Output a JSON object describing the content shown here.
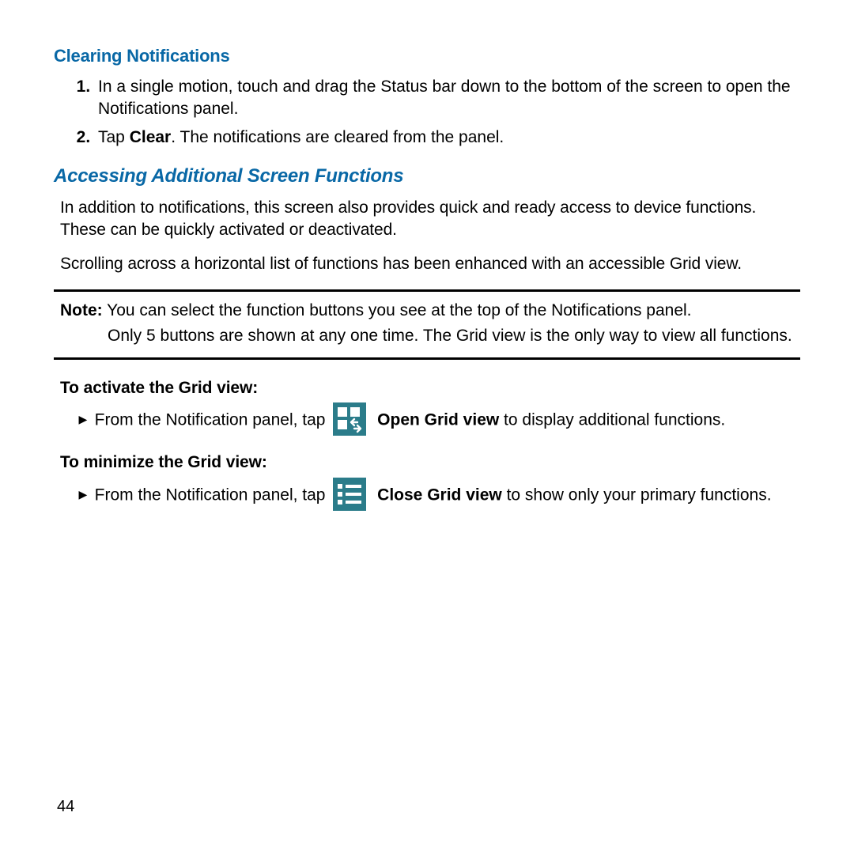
{
  "section1": {
    "heading": "Clearing Notifications",
    "steps": [
      {
        "text_before": "In a single motion, touch and drag the Status bar down to the bottom of the screen to open the Notifications panel."
      },
      {
        "text_before": "Tap ",
        "bold": "Clear",
        "text_after": ". The notifications are cleared from the panel."
      }
    ]
  },
  "section2": {
    "heading": "Accessing Additional Screen Functions",
    "para1": "In addition to notifications, this screen also provides quick and ready access to device functions. These can be quickly activated or deactivated.",
    "para2": "Scrolling across a horizontal list of functions has been enhanced with an accessible Grid view."
  },
  "note": {
    "label": "Note:",
    "line1": " You can select the function buttons you see at the top of the Notifications panel.",
    "line2": "Only 5 buttons are shown at any one time. The Grid view is the only way to view all functions."
  },
  "gridview": {
    "activate_heading": "To activate the Grid view:",
    "activate_arrow": "►",
    "activate_before": " From the Notification panel, tap ",
    "activate_bold": "Open Grid view",
    "activate_after": " to display additional functions.",
    "minimize_heading": "To minimize the Grid view:",
    "minimize_arrow": "►",
    "minimize_before": " From the Notification panel, tap ",
    "minimize_bold": "Close Grid view",
    "minimize_after": " to show only your primary functions."
  },
  "page_number": "44"
}
